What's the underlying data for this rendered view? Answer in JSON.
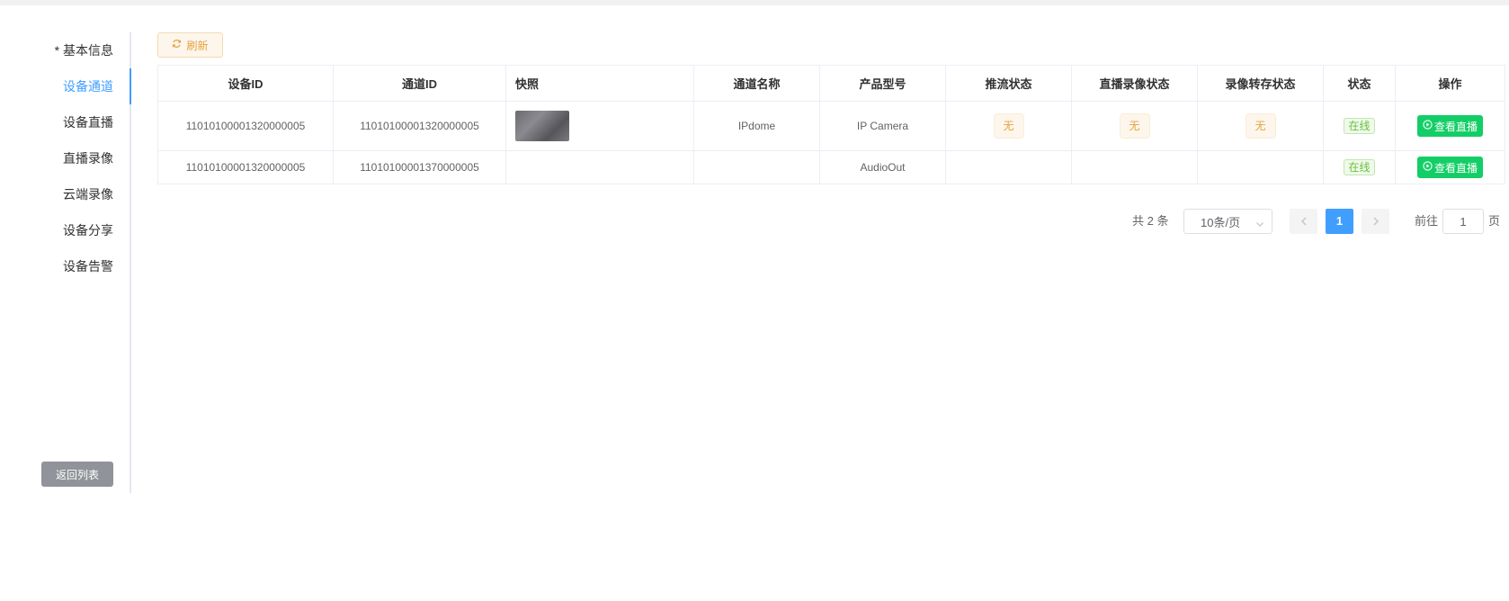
{
  "sidebar": {
    "items": [
      {
        "label": "* 基本信息",
        "active": false
      },
      {
        "label": "设备通道",
        "active": true
      },
      {
        "label": "设备直播",
        "active": false
      },
      {
        "label": "直播录像",
        "active": false
      },
      {
        "label": "云端录像",
        "active": false
      },
      {
        "label": "设备分享",
        "active": false
      },
      {
        "label": "设备告警",
        "active": false
      }
    ],
    "back_label": "返回列表"
  },
  "toolbar": {
    "refresh_label": "刷新",
    "refresh_icon": "refresh-icon"
  },
  "table": {
    "headers": [
      "设备ID",
      "通道ID",
      "快照",
      "通道名称",
      "产品型号",
      "推流状态",
      "直播录像状态",
      "录像转存状态",
      "状态",
      "操作"
    ],
    "rows": [
      {
        "device_id": "11010100001320000005",
        "channel_id": "11010100001320000005",
        "has_snapshot": true,
        "channel_name": "IPdome",
        "product_model": "IP Camera",
        "push_status": "无",
        "live_record_status": "无",
        "record_transfer_status": "无",
        "status": "在线",
        "action": "查看直播"
      },
      {
        "device_id": "11010100001320000005",
        "channel_id": "11010100001370000005",
        "has_snapshot": false,
        "channel_name": "",
        "product_model": "AudioOut",
        "push_status": "",
        "live_record_status": "",
        "record_transfer_status": "",
        "status": "在线",
        "action": "查看直播"
      }
    ]
  },
  "pagination": {
    "total_text": "共 2 条",
    "page_size": "10条/页",
    "current_page": "1",
    "goto_label": "前往",
    "goto_value": "1",
    "page_suffix": "页"
  },
  "colors": {
    "primary": "#409eff",
    "warning": "#e6a23c",
    "success": "#67c23a",
    "live_button": "#13ce66",
    "info_button": "#909399"
  }
}
